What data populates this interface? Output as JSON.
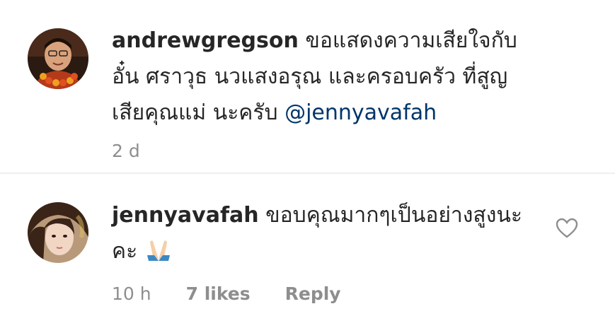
{
  "comments": [
    {
      "username": "andrewgregson",
      "text": "ขอแสดงความเสียใจกับ อั๋น ศราวุธ นวแสงอรุณ และครอบครัว ที่สูญเสียคุณแม่ นะครับ",
      "mention": "@jennyavafah",
      "time": "2 d"
    },
    {
      "username": "jennyavafah",
      "text": "ขอบคุณมากๆเป็นอย่างสูงนะคะ",
      "emoji": "folded-hands-emoji",
      "time": "10 h",
      "likes": "7 likes",
      "reply": "Reply"
    }
  ],
  "colors": {
    "mention": "#003569",
    "meta": "#8e8e8e",
    "divider": "#efefef"
  }
}
